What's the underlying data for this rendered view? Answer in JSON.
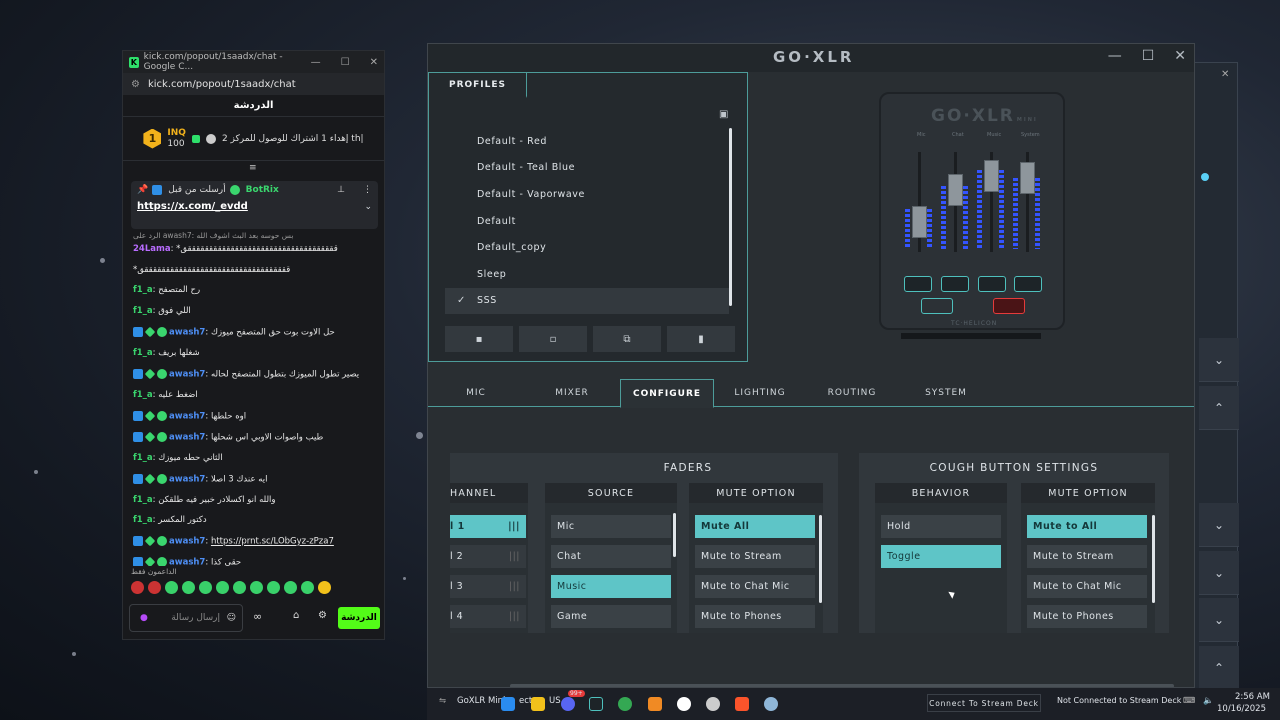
{
  "chat_window": {
    "title": "kick.com/popout/1saadx/chat - Google C...",
    "url": "kick.com/popout/1saadx/chat",
    "header": "الدردشة",
    "leaderboard": {
      "rank": "1",
      "name": "INQ",
      "points": "100",
      "goal_text": "إهداء 1 اشتراك للوصول للمركز 2 th|"
    },
    "pinned": {
      "author": "BotRix",
      "label": "أرسلت من قبل",
      "link": "https://x.com/_evdd"
    },
    "reply_hint": "الرد على awash7: بس حوسه بعد البث اشوف الله",
    "messages": [
      {
        "user": "24Lama",
        "text": "*قققققققققققققققققققققققققققققققققققق",
        "color": "#b96cff",
        "badges": []
      },
      {
        "user": "",
        "text": "*ققققققققققققققققققققققققققققققققققق",
        "color": "#ffffff",
        "badges": []
      },
      {
        "user": "f1_a",
        "text": "رح المتصفح",
        "color": "#3ad66e",
        "badges": []
      },
      {
        "user": "f1_a",
        "text": "اللي فوق",
        "color": "#3ad66e",
        "badges": []
      },
      {
        "user": "awash7",
        "text": "حل الاوت بوت حق المتصفح ميوزك",
        "color": "#4e8ff5",
        "badges": [
          "blue",
          "green",
          "ok"
        ]
      },
      {
        "user": "f1_a",
        "text": "شغلها بريف",
        "color": "#3ad66e",
        "badges": []
      },
      {
        "user": "awash7",
        "text": "يصير تطول الميوزك بتطول المتصفح لحاله",
        "color": "#4e8ff5",
        "badges": [
          "blue",
          "green",
          "ok"
        ]
      },
      {
        "user": "f1_a",
        "text": "اضغط عليه",
        "color": "#3ad66e",
        "badges": []
      },
      {
        "user": "awash7",
        "text": "اوه حلطها",
        "color": "#4e8ff5",
        "badges": [
          "blue",
          "green",
          "ok"
        ]
      },
      {
        "user": "awash7",
        "text": "طيب واصوات الاوبي اس شحلها",
        "color": "#4e8ff5",
        "badges": [
          "blue",
          "green",
          "ok"
        ]
      },
      {
        "user": "f1_a",
        "text": "الثاني حطه ميوزك",
        "color": "#3ad66e",
        "badges": []
      },
      {
        "user": "awash7",
        "text": "ايه عندك 3 اصلا",
        "color": "#4e8ff5",
        "badges": [
          "blue",
          "green",
          "ok"
        ]
      },
      {
        "user": "f1_a",
        "text": "والله انو اكسلادر خبير فيه طلقكن",
        "color": "#3ad66e",
        "badges": []
      },
      {
        "user": "f1_a",
        "text": "دكتور المكسر",
        "color": "#3ad66e",
        "badges": []
      },
      {
        "user": "awash7",
        "text": "https://prnt.sc/LObGyz-zPza7",
        "color": "#4e8ff5",
        "badges": [
          "blue",
          "green",
          "ok"
        ]
      },
      {
        "user": "awash7",
        "text": "حقي كذا",
        "color": "#4e8ff5",
        "badges": [
          "blue",
          "green",
          "ok"
        ]
      }
    ],
    "supporters_label": "الداعمون فقط",
    "input_placeholder": "إرسال رسالة",
    "send_label": "الدردشة"
  },
  "goxlr": {
    "title": "GO·XLR",
    "profiles_tab": "PROFILES",
    "profiles": [
      {
        "name": "Default - Red",
        "active": false
      },
      {
        "name": "Default - Teal Blue",
        "active": false
      },
      {
        "name": "Default - Vaporwave",
        "active": false
      },
      {
        "name": "Default",
        "active": false
      },
      {
        "name": "Default_copy",
        "active": false
      },
      {
        "name": "Sleep",
        "active": false
      },
      {
        "name": "SSS",
        "active": true
      }
    ],
    "device": {
      "logo": "GO·XLR",
      "logo_suffix": "MINI",
      "fader_labels": [
        "Mic",
        "Chat",
        "Music",
        "System"
      ],
      "footer": "TC·HELICON"
    },
    "tabs": [
      "MIC",
      "MIXER",
      "CONFIGURE",
      "LIGHTING",
      "ROUTING",
      "SYSTEM"
    ],
    "active_tab": "CONFIGURE",
    "faders": {
      "title": "FADERS",
      "channel_header": "HANNEL",
      "channels": [
        "l 1",
        "l 2",
        "l 3",
        "l 4"
      ],
      "source_header": "SOURCE",
      "sources": [
        "Mic",
        "Chat",
        "Music",
        "Game"
      ],
      "selected_source": "Music",
      "mute_header": "MUTE OPTION",
      "mute_options": [
        "Mute All",
        "Mute to Stream",
        "Mute to Chat Mic",
        "Mute to Phones"
      ],
      "selected_mute": "Mute All"
    },
    "cough": {
      "title": "COUGH BUTTON SETTINGS",
      "behavior_header": "BEHAVIOR",
      "behaviors": [
        "Hold",
        "Toggle"
      ],
      "selected_behavior": "Toggle",
      "mute_header": "MUTE OPTION",
      "mute_options": [
        "Mute to All",
        "Mute to Stream",
        "Mute to Chat Mic",
        "Mute to Phones"
      ],
      "selected_mute": "Mute to All"
    }
  },
  "taskbar": {
    "app_label": "GoXLR Mini",
    "app_suffix": "ecte",
    "lang": "US",
    "stream_deck_button": "Connect To Stream Deck",
    "stream_deck_status": "Not Connected to Stream Deck",
    "time": "2:56 AM",
    "date": "10/16/2025",
    "discord_badge": "99+"
  },
  "colors": {
    "accent_teal": "#5ec5c7",
    "kick_green": "#53fc18",
    "cough_red": "#e53b3b"
  }
}
